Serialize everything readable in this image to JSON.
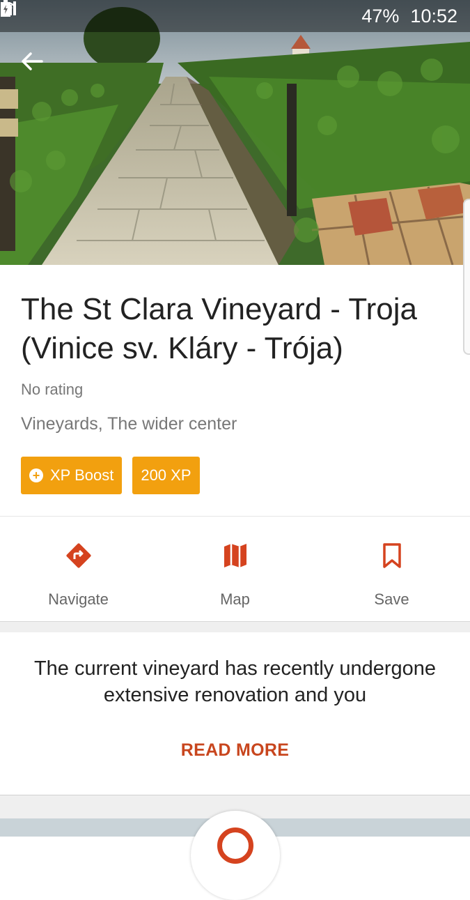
{
  "status_bar": {
    "battery": "47%",
    "time": "10:52",
    "icons": [
      "wifi-icon",
      "signal-icon",
      "battery-icon"
    ]
  },
  "hero": {
    "image_description_icon": "vineyard-photo"
  },
  "place": {
    "title": "The St Clara Vineyard - Troja (Vinice sv. Kláry - Trója)",
    "rating": "No rating",
    "category": "Vineyards, The wider center"
  },
  "badges": {
    "boost_label": "XP Boost",
    "xp_label": "200 XP"
  },
  "actions": {
    "navigate_label": "Navigate",
    "map_label": "Map",
    "save_label": "Save"
  },
  "description": {
    "text": "The current vineyard has recently undergone extensive renovation and you",
    "read_more": "READ MORE"
  },
  "colors": {
    "accent": "#d5431f",
    "badge": "#f2a00f"
  }
}
